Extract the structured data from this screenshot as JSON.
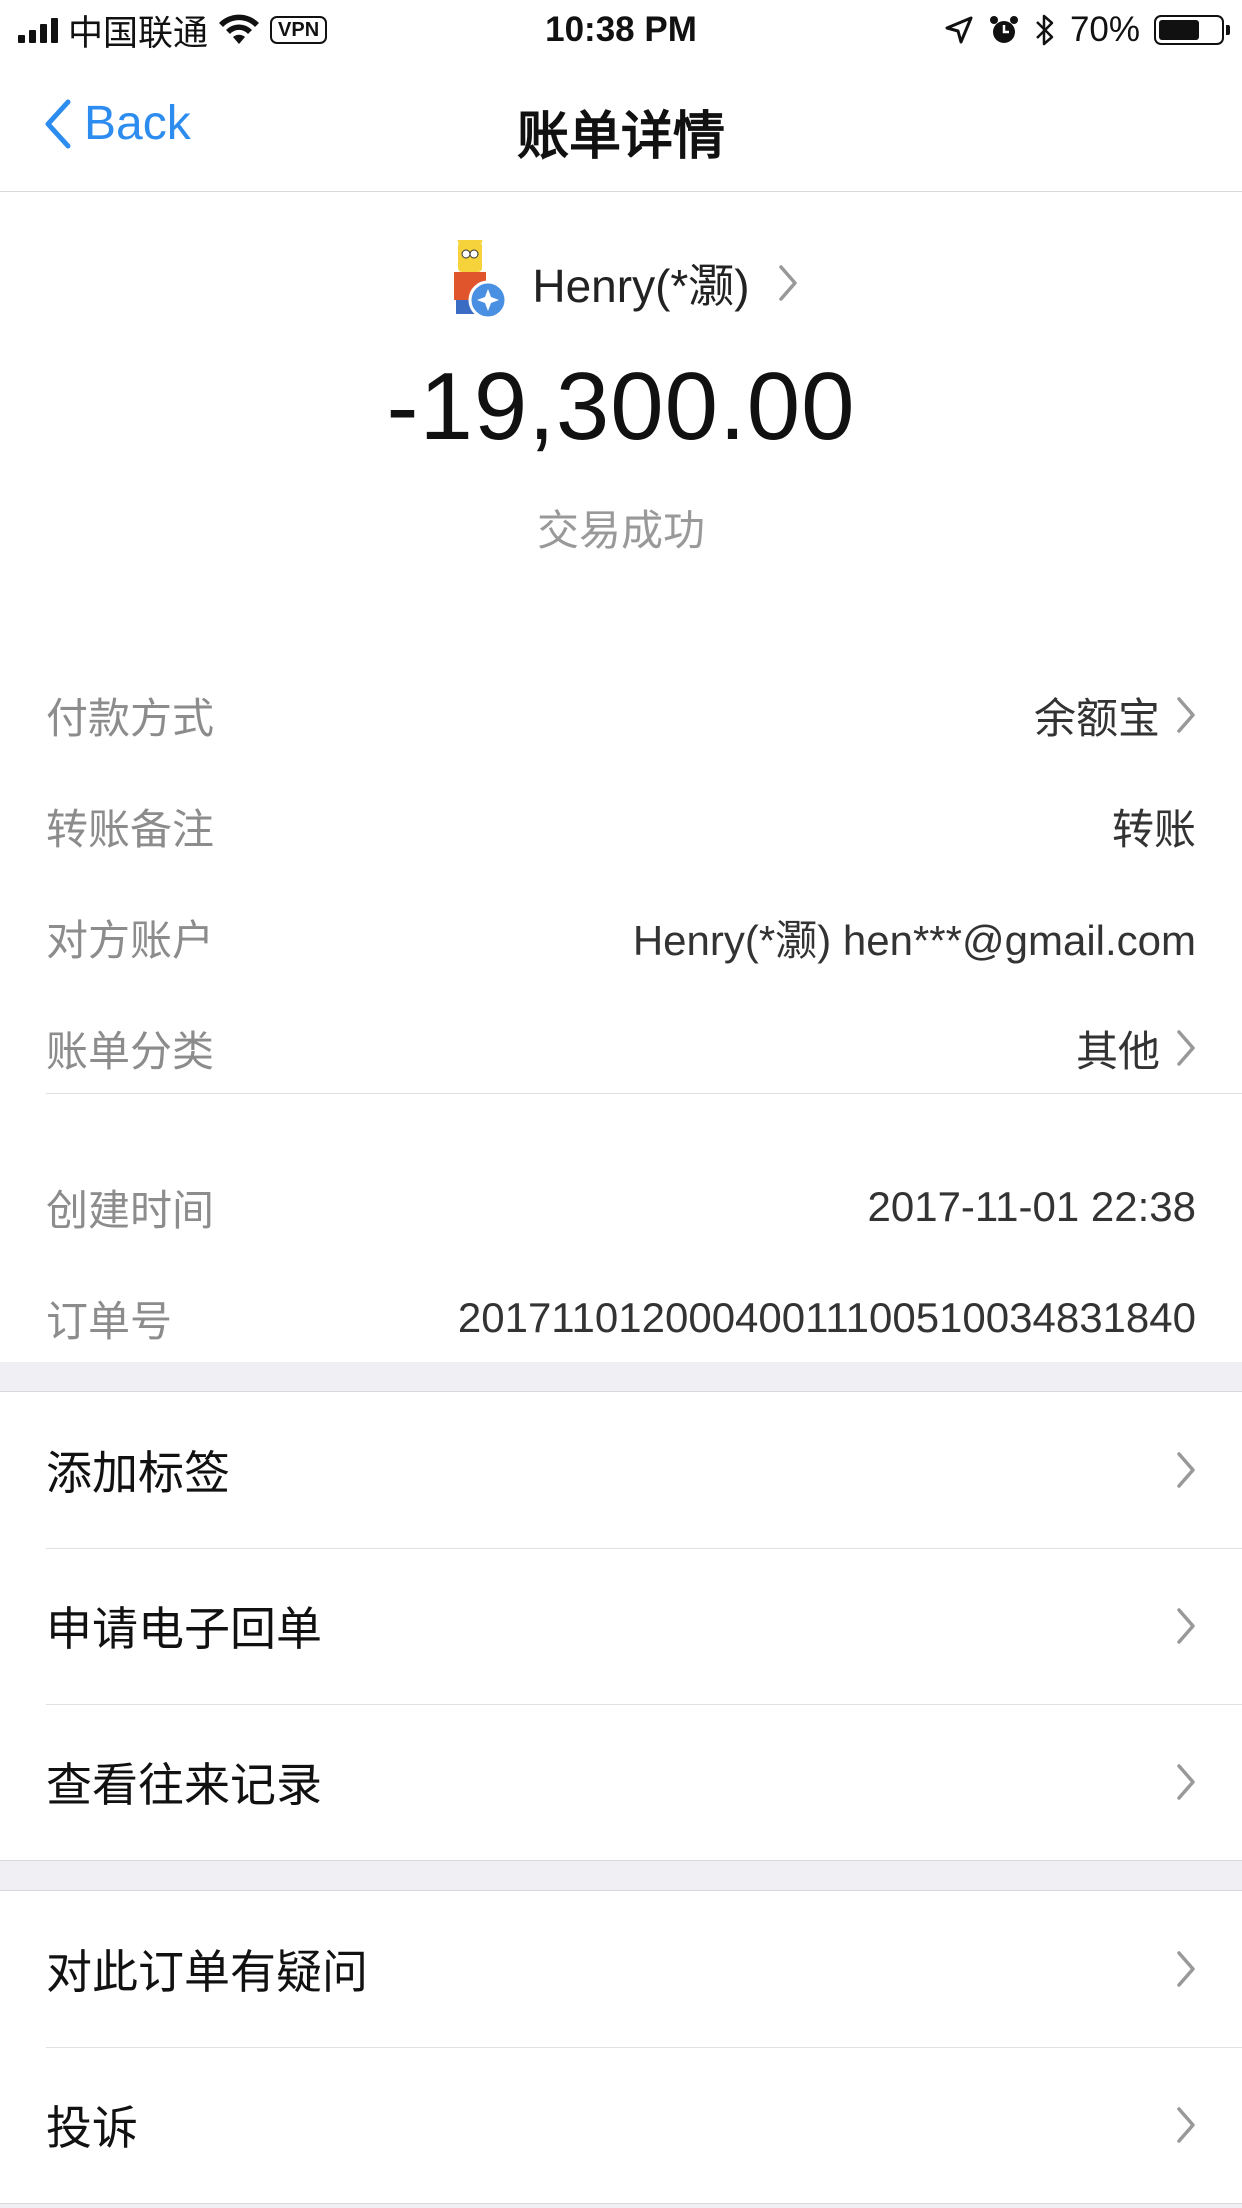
{
  "status_bar": {
    "carrier": "中国联通",
    "vpn": "VPN",
    "time": "10:38 PM",
    "battery": "70%",
    "battery_level": 0.7
  },
  "nav": {
    "back_label": "Back",
    "title": "账单详情"
  },
  "header": {
    "payee_name": "Henry(*灏)",
    "amount": "-19,300.00",
    "status": "交易成功"
  },
  "details": [
    {
      "label": "付款方式",
      "value": "余额宝"
    },
    {
      "label": "转账备注",
      "value": "转账"
    },
    {
      "label": "对方账户",
      "value": "Henry(*灏) hen***@gmail.com"
    },
    {
      "label": "账单分类",
      "value": "其他"
    },
    {
      "label": "创建时间",
      "value": "2017-11-01 22:38"
    },
    {
      "label": "订单号",
      "value": "20171101200040011100510034831840"
    }
  ],
  "actions_group1": [
    {
      "label": "添加标签"
    },
    {
      "label": "申请电子回单"
    },
    {
      "label": "查看往来记录"
    }
  ],
  "actions_group2": [
    {
      "label": "对此订单有疑问"
    },
    {
      "label": "投诉"
    }
  ],
  "colors": {
    "accent": "#2d8cf0",
    "background": "#efeff4"
  }
}
